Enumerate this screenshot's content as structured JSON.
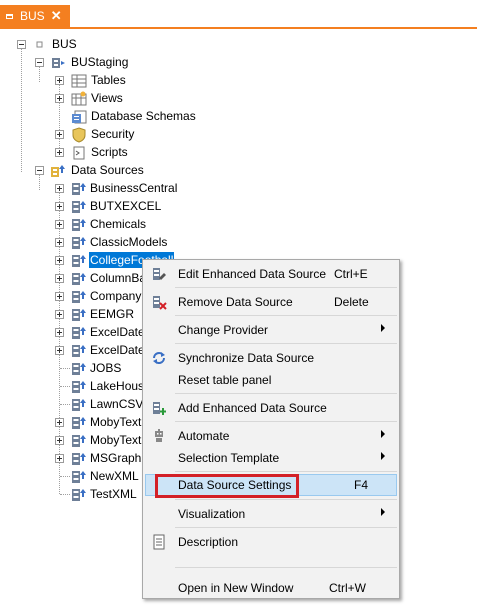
{
  "tab": {
    "label": "BUS",
    "close": "✕"
  },
  "tree": {
    "root": "BUS",
    "staging": {
      "label": "BUStaging",
      "children": [
        "Tables",
        "Views",
        "Database Schemas",
        "Security",
        "Scripts"
      ]
    },
    "data_sources": {
      "label": "Data Sources",
      "items": [
        "BusinessCentral",
        "BUTXEXCEL",
        "Chemicals",
        "ClassicModels",
        "CollegeFootball",
        "ColumnBas",
        "CompanyB",
        "EEMGR",
        "ExcelDates",
        "ExcelDates",
        "JOBS",
        "LakeHouse",
        "LawnCSV",
        "MobyText",
        "MobyTextM",
        "MSGraph",
        "NewXML",
        "TestXML"
      ],
      "selected": "CollegeFootball"
    }
  },
  "menu": {
    "items": [
      {
        "label": "Edit Enhanced Data Source",
        "shortcut": "Ctrl+E",
        "icon": "edit-datasource-icon"
      },
      {
        "label": "Remove Data Source",
        "shortcut": "Delete",
        "icon": "remove-datasource-icon"
      },
      {
        "label": "Change Provider",
        "submenu": true
      },
      {
        "label": "Synchronize Data Source",
        "icon": "sync-icon"
      },
      {
        "label": "Reset table panel"
      },
      {
        "label": "Add Enhanced Data Source",
        "icon": "add-datasource-icon"
      },
      {
        "label": "Automate",
        "submenu": true,
        "icon": "robot-icon"
      },
      {
        "label": "Selection Template",
        "submenu": true
      },
      {
        "label": "Data Source Settings",
        "shortcut": "F4",
        "highlighted": true
      },
      {
        "label": "Visualization",
        "submenu": true
      },
      {
        "label": "Description",
        "icon": "description-icon"
      },
      {
        "label": "Open in New Window",
        "shortcut": "Ctrl+W"
      }
    ]
  },
  "colors": {
    "accent": "#f47f20",
    "selection": "#0078d7",
    "menu_highlight": "#cce4f7",
    "annotation": "#d32027"
  }
}
